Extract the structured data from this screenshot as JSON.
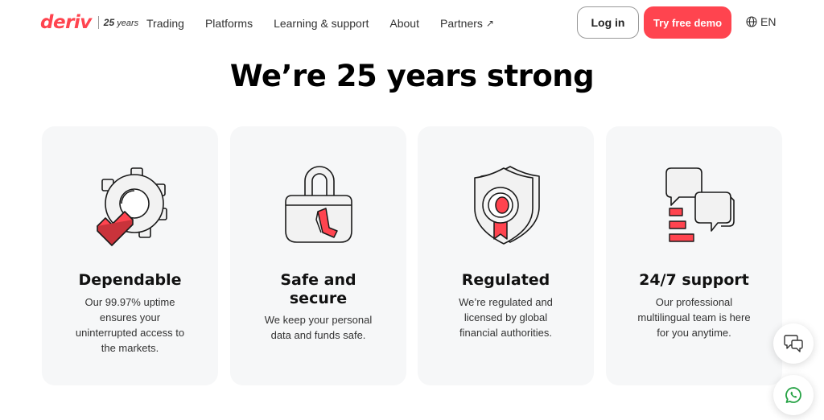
{
  "brand": {
    "name": "deriv",
    "years_number": "25",
    "years_word": "years",
    "accent": "#ff444f"
  },
  "nav": {
    "links": [
      "Trading",
      "Platforms",
      "Learning & support",
      "About",
      "Partners"
    ],
    "partners_arrow": "↗",
    "login_label": "Log in",
    "demo_label": "Try free demo",
    "language": "EN"
  },
  "headline": "We’re 25 years strong",
  "cards": [
    {
      "title": "Dependable",
      "description": "Our 99.97% uptime ensures your uninterrupted access to the markets.",
      "icon": "gear-check-icon"
    },
    {
      "title": "Safe and secure",
      "description": "We keep your personal data and funds safe.",
      "icon": "padlock-icon"
    },
    {
      "title": "Regulated",
      "description": "We’re regulated and licensed by global financial authorities.",
      "icon": "shield-badge-icon"
    },
    {
      "title": "24/7 support",
      "description": "Our professional multilingual team is here for you anytime.",
      "icon": "chat-bubbles-icon"
    }
  ],
  "floating": {
    "chat": "live-chat-icon",
    "whatsapp": "whatsapp-icon"
  }
}
